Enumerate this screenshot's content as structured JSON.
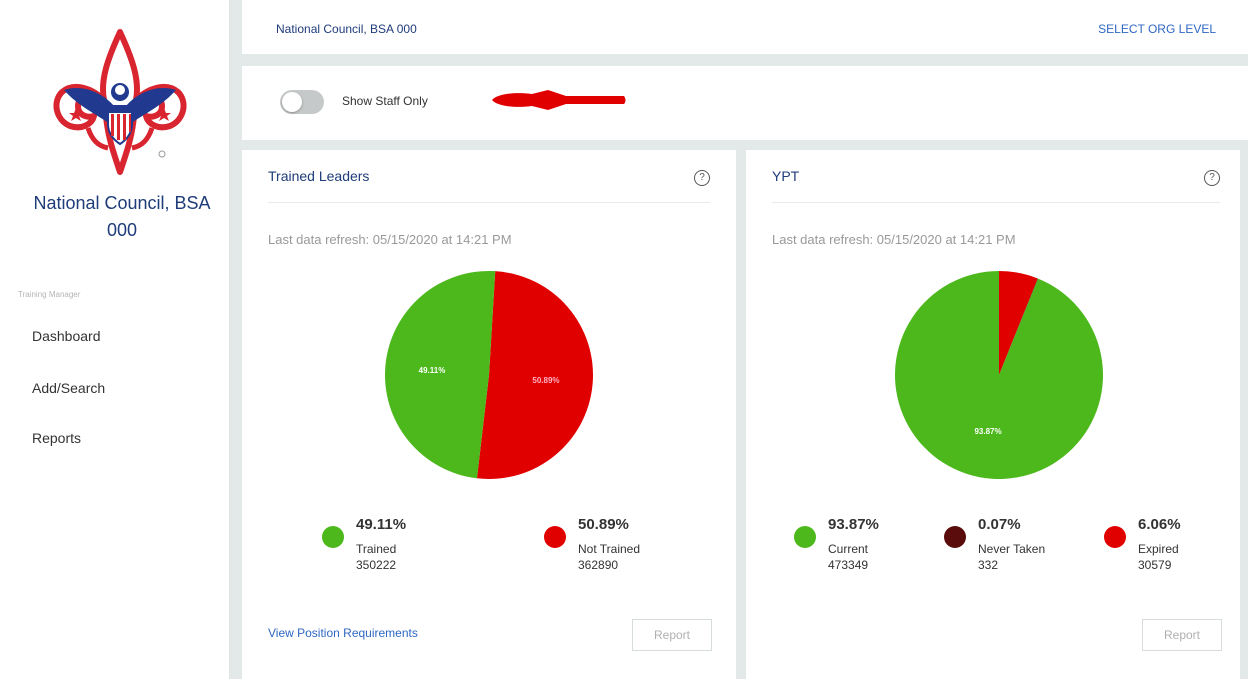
{
  "sidebar": {
    "org_name": "National Council, BSA 000",
    "section_label": "Training Manager",
    "nav": [
      {
        "label": "Dashboard"
      },
      {
        "label": "Add/Search"
      },
      {
        "label": "Reports"
      }
    ]
  },
  "topbar": {
    "org_name": "National Council, BSA 000",
    "select_org": "SELECT ORG LEVEL"
  },
  "toggle": {
    "label": "Show Staff Only",
    "on": false
  },
  "colors": {
    "green": "#4cb81c",
    "red": "#e00000",
    "dark_red": "#5a0b0b",
    "blue": "#1f3c7a",
    "link": "#2f67c3"
  },
  "cards": {
    "trained": {
      "title": "Trained Leaders",
      "refresh": "Last data refresh: 05/15/2020 at 14:21 PM",
      "link": "View Position Requirements",
      "report": "Report"
    },
    "ypt": {
      "title": "YPT",
      "refresh": "Last data refresh: 05/15/2020 at 14:21 PM",
      "report": "Report"
    }
  },
  "chart_data": [
    {
      "type": "pie",
      "slices": [
        {
          "label": "Trained",
          "pct": 49.11,
          "pct_text": "49.11%",
          "count": "350222",
          "color": "#4cb81c",
          "slice_label": "49.11%"
        },
        {
          "label": "Not Trained",
          "pct": 50.89,
          "pct_text": "50.89%",
          "count": "362890",
          "color": "#e00000",
          "slice_label": "50.89%"
        }
      ]
    },
    {
      "type": "pie",
      "slices": [
        {
          "label": "Current",
          "pct": 93.87,
          "pct_text": "93.87%",
          "count": "473349",
          "color": "#4cb81c",
          "slice_label": "93.87%"
        },
        {
          "label": "Never Taken",
          "pct": 0.07,
          "pct_text": "0.07%",
          "count": "332",
          "color": "#5a0b0b",
          "slice_label": ""
        },
        {
          "label": "Expired",
          "pct": 6.06,
          "pct_text": "6.06%",
          "count": "30579",
          "color": "#e00000",
          "slice_label": ""
        }
      ]
    }
  ]
}
